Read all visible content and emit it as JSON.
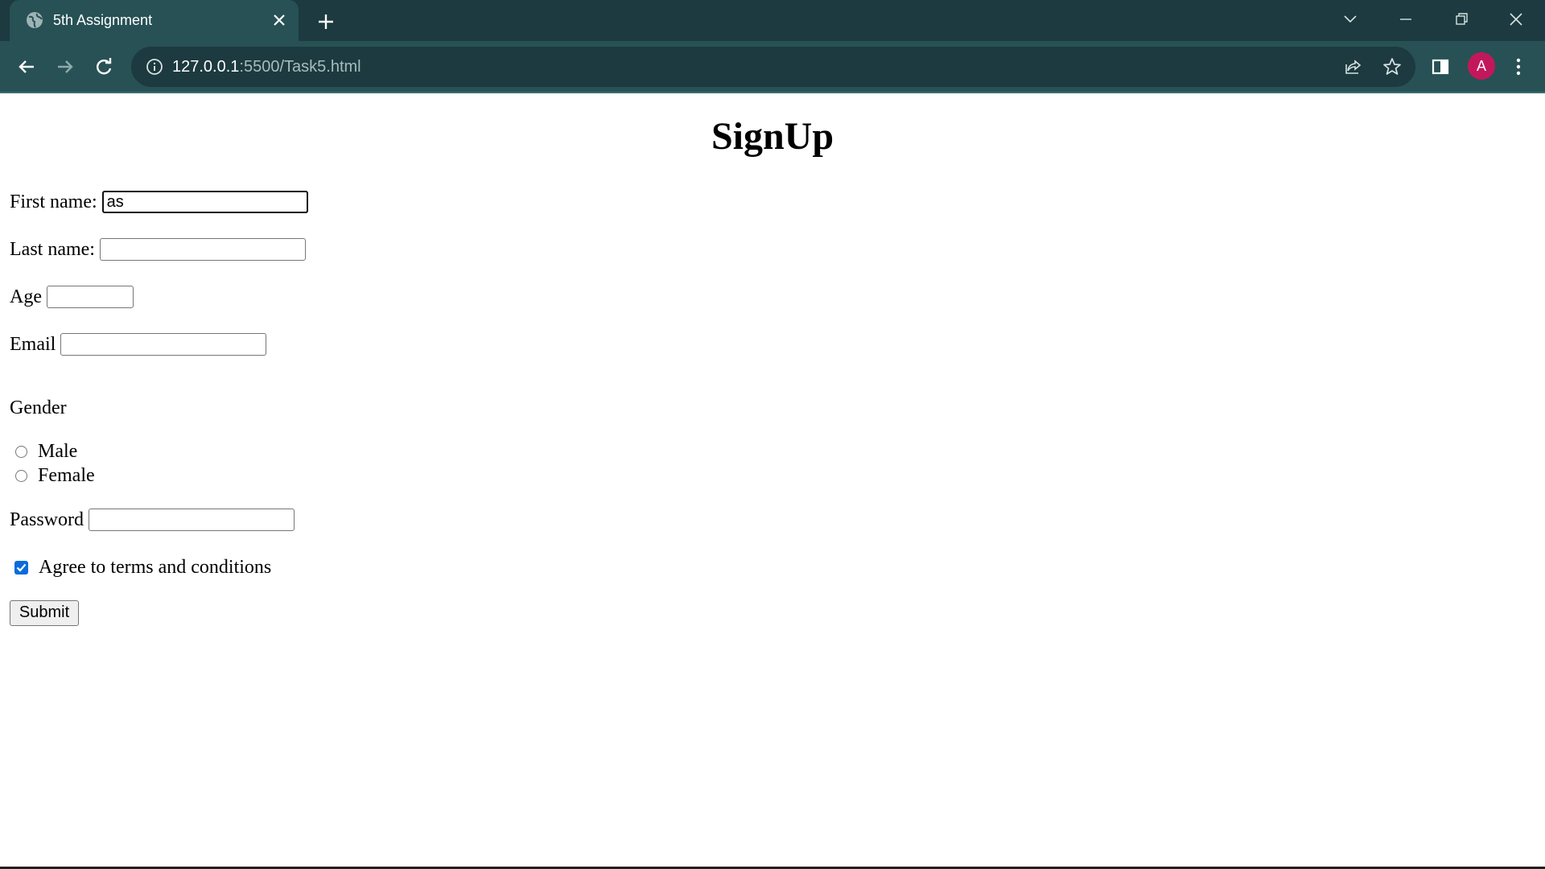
{
  "browser": {
    "tab_title": "5th Assignment",
    "url_host": "127.0.0.1",
    "url_rest": ":5500/Task5.html",
    "profile_initial": "A",
    "profile_color": "#c2185b",
    "accent_bg": "#275155"
  },
  "icons": {
    "favicon": "globe-icon",
    "tab_close": "close-icon",
    "new_tab": "plus-icon",
    "tab_search": "chevron-down-icon",
    "minimize": "minimize-icon",
    "restore": "restore-icon",
    "close_window": "close-icon",
    "back": "back-arrow-icon",
    "forward": "forward-arrow-icon",
    "reload": "reload-icon",
    "site_info": "info-icon",
    "share": "share-icon",
    "bookmark": "star-icon",
    "side_panel": "side-panel-icon",
    "menu": "kebab-menu-icon"
  },
  "form": {
    "title": "SignUp",
    "first_name_label": "First name:",
    "first_name_value": "as",
    "last_name_label": "Last name:",
    "last_name_value": "",
    "age_label": "Age",
    "age_value": "",
    "email_label": "Email",
    "email_value": "",
    "gender_label": "Gender",
    "gender_options": [
      "Male",
      "Female"
    ],
    "gender_selected": null,
    "password_label": "Password",
    "password_value": "",
    "terms_label": "Agree to terms and conditions",
    "terms_checked": true,
    "submit_label": "Submit",
    "checkbox_color": "#0b6bdc"
  }
}
